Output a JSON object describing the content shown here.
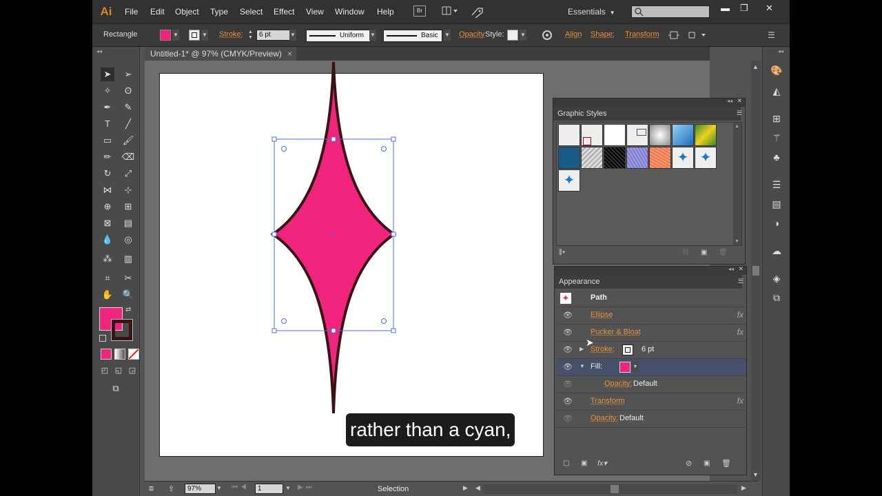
{
  "app": {
    "logo": "Ai"
  },
  "menubar": {
    "items": [
      "File",
      "Edit",
      "Object",
      "Type",
      "Select",
      "Effect",
      "View",
      "Window",
      "Help"
    ],
    "bridge": "Br",
    "workspace": "Essentials",
    "search_placeholder": "",
    "win_minimize": "▬",
    "win_restore": "❐",
    "win_close": "✕"
  },
  "controlbar": {
    "selection_type": "Rectangle",
    "fill_color": "#f0247c",
    "stroke_label": "Stroke:",
    "stroke_weight": "6 pt",
    "stroke_profile": "Uniform",
    "brush": "Basic",
    "opacity_label": "Opacity",
    "style_label": "Style:",
    "align_label": "Align",
    "shape_label": "Shape:",
    "transform_label": "Transform"
  },
  "document": {
    "tab_title": "Untitled-1* @ 97% (CMYK/Preview)",
    "tab_close": "×"
  },
  "statusbar": {
    "zoom": "97%",
    "artboard_number": "1",
    "status_text": "Selection"
  },
  "graphic_styles": {
    "title": "Graphic Styles"
  },
  "appearance": {
    "title": "Appearance",
    "path_label": "Path",
    "rows": {
      "ellipse": "Ellipse",
      "pucker": "Pucker & Bloat",
      "stroke_name": "Stroke:",
      "stroke_value": "6 pt",
      "fill_name": "Fill:",
      "fill_opacity_name": "Opacity:",
      "fill_opacity_value": "Default",
      "transform": "Transform",
      "opacity_name": "Opacity:",
      "opacity_value": "Default"
    },
    "fx_label": "fx"
  },
  "caption": {
    "text": "rather than a cyan,"
  },
  "colors": {
    "accent": "#e8923a",
    "fill": "#f0247c",
    "stroke": "#3a1414",
    "selection": "#4a6fdc"
  }
}
